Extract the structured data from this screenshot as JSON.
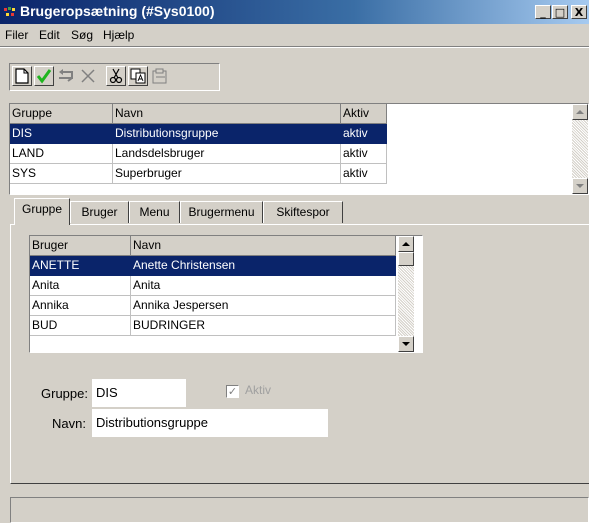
{
  "window": {
    "title": "Brugeropsætning (#Sys0100)",
    "controls": {
      "minimize": "_",
      "maximize": "□",
      "close": "X"
    }
  },
  "menu": {
    "items": [
      "Filer",
      "Edit",
      "Søg",
      "Hjælp"
    ]
  },
  "toolbar": {
    "buttons": [
      "new-document-icon",
      "confirm-check-icon",
      "undo-icon",
      "delete-x-icon",
      "cut-scissors-icon",
      "copy-icon",
      "paste-icon"
    ],
    "colors": {
      "check": "#1fb51f"
    }
  },
  "groups_table": {
    "columns": [
      "Gruppe",
      "Navn",
      "Aktiv"
    ],
    "rows": [
      {
        "gruppe": "DIS",
        "navn": "Distributionsgruppe",
        "aktiv": "aktiv"
      },
      {
        "gruppe": "LAND",
        "navn": "Landsdelsbruger",
        "aktiv": "aktiv"
      },
      {
        "gruppe": "SYS",
        "navn": "Superbruger",
        "aktiv": "aktiv"
      }
    ],
    "selected_index": 0
  },
  "tabs": [
    "Gruppe",
    "Bruger",
    "Menu",
    "Brugermenu",
    "Skiftespor"
  ],
  "active_tab": "Gruppe",
  "users_table": {
    "columns": [
      "Bruger",
      "Navn"
    ],
    "rows": [
      {
        "bruger": "ANETTE",
        "navn": "Anette Christensen"
      },
      {
        "bruger": "Anita",
        "navn": "Anita"
      },
      {
        "bruger": "Annika",
        "navn": "Annika Jespersen"
      },
      {
        "bruger": "BUD",
        "navn": "BUDRINGER"
      }
    ],
    "selected_index": 0
  },
  "form": {
    "gruppe_label": "Gruppe:",
    "gruppe_value": "DIS",
    "aktiv_label": "Aktiv",
    "aktiv_checked": true,
    "navn_label": "Navn:",
    "navn_value": "Distributionsgruppe"
  },
  "colors": {
    "selection": "#0a246a",
    "titlebar": "#0a246a",
    "face": "#d4d0c8"
  }
}
